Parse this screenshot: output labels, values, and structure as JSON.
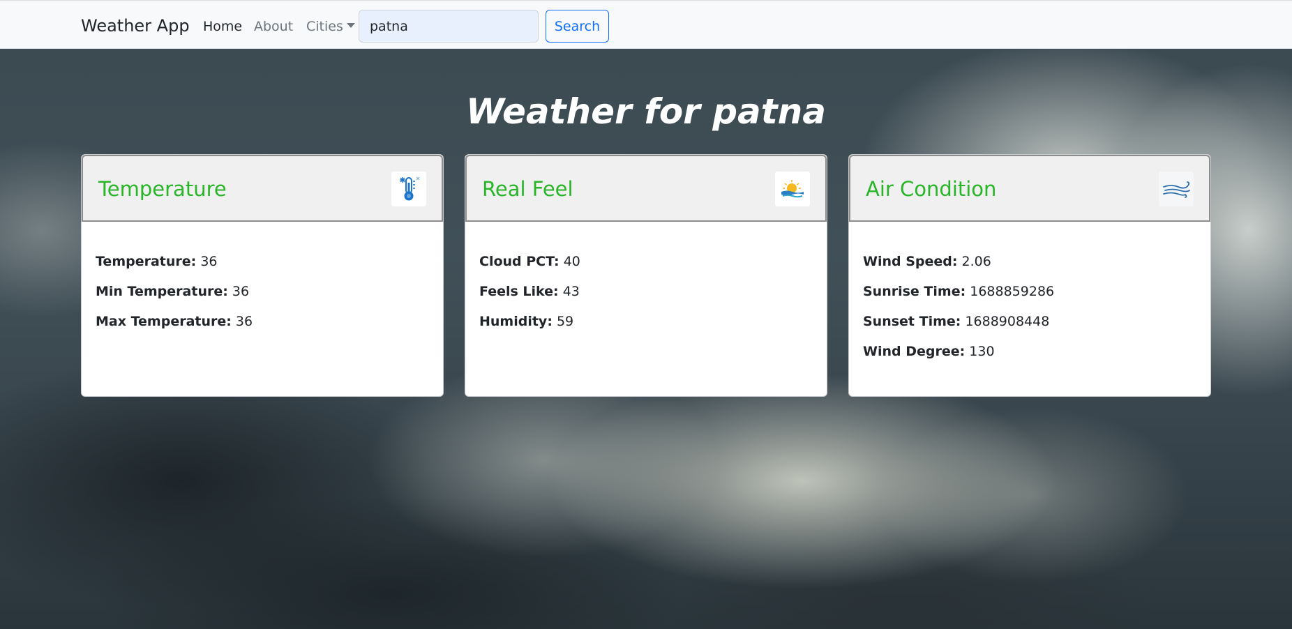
{
  "navbar": {
    "brand": "Weather App",
    "links": [
      {
        "label": "Home",
        "active": true
      },
      {
        "label": "About",
        "active": false
      },
      {
        "label": "Cities",
        "active": false
      }
    ],
    "search": {
      "value": "patna",
      "button_label": "Search"
    }
  },
  "page": {
    "title": "Weather for patna"
  },
  "colors": {
    "card_title": "#28b528",
    "accent": "#0d6efd"
  },
  "cards": [
    {
      "title": "Temperature",
      "icon": "thermometer-icon",
      "rows": [
        {
          "label": "Temperature:",
          "value": "36"
        },
        {
          "label": "Min Temperature:",
          "value": "36"
        },
        {
          "label": "Max Temperature:",
          "value": "36"
        }
      ]
    },
    {
      "title": "Real Feel",
      "icon": "sun-over-water-icon",
      "rows": [
        {
          "label": "Cloud PCT:",
          "value": "40"
        },
        {
          "label": "Feels Like:",
          "value": "43"
        },
        {
          "label": "Humidity:",
          "value": "59"
        }
      ]
    },
    {
      "title": "Air Condition",
      "icon": "wind-icon",
      "rows": [
        {
          "label": "Wind Speed:",
          "value": "2.06"
        },
        {
          "label": "Sunrise Time:",
          "value": "1688859286"
        },
        {
          "label": "Sunset Time:",
          "value": "1688908448"
        },
        {
          "label": "Wind Degree:",
          "value": "130"
        }
      ]
    }
  ]
}
